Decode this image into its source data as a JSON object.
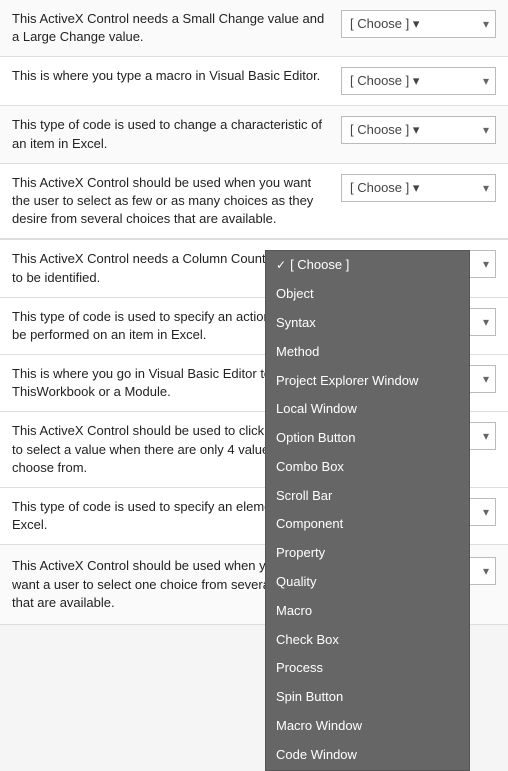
{
  "questions": [
    {
      "id": "q1",
      "text": "This ActiveX Control needs a Small Change value and a Large Change value.",
      "dropdown_value": "[ Choose ]",
      "open": false
    },
    {
      "id": "q2",
      "text": "This is where you type a macro in Visual Basic Editor.",
      "dropdown_value": "[ Choose ]",
      "open": false
    },
    {
      "id": "q3",
      "text": "This type of code is used to change a characteristic of an item in Excel.",
      "dropdown_value": "[ Choose ]",
      "open": false
    },
    {
      "id": "q4",
      "text": "This ActiveX Control should be used when you want the user to select as few or as many choices as they desire from several choices that are available.",
      "dropdown_value": "[ Choose ]",
      "open": false
    },
    {
      "id": "q5",
      "text": "This ActiveX Control needs a Column Count property to be identified.",
      "dropdown_value": "[ Choose ]",
      "open": true
    },
    {
      "id": "q6",
      "text": "This type of code is used to specify an action that will be performed on an item in Excel.",
      "dropdown_value": "[ Choose ]",
      "open": false,
      "behind_menu": true
    },
    {
      "id": "q7",
      "text": "This is where you go in Visual Basic Editor to access ThisWorkbook or a Module.",
      "dropdown_value": "[ Choose ]",
      "open": false,
      "behind_menu": true
    },
    {
      "id": "q8",
      "text": "This ActiveX Control should be used to click on arrows to select a value when there are only 4 values to choose from.",
      "dropdown_value": "[ Choose ]",
      "open": false,
      "behind_menu": true
    },
    {
      "id": "q9",
      "text": "This type of code is used to specify an element of Excel.",
      "dropdown_value": "[ Choose ]",
      "open": false,
      "behind_menu": true
    }
  ],
  "last_question": {
    "text": "This ActiveX Control should be used when you only want a user to select one choice from several choices that are available.",
    "dropdown_value": "[ Choose ]"
  },
  "dropdown_menu": {
    "items": [
      {
        "label": "[ Choose ]",
        "selected": true
      },
      {
        "label": "Object"
      },
      {
        "label": "Syntax"
      },
      {
        "label": "Method"
      },
      {
        "label": "Project Explorer Window"
      },
      {
        "label": "Local Window"
      },
      {
        "label": "Option Button"
      },
      {
        "label": "Combo Box"
      },
      {
        "label": "Scroll Bar"
      },
      {
        "label": "Component"
      },
      {
        "label": "Property"
      },
      {
        "label": "Quality"
      },
      {
        "label": "Macro"
      },
      {
        "label": "Check Box"
      },
      {
        "label": "Process"
      },
      {
        "label": "Spin Button"
      },
      {
        "label": "Macro Window"
      },
      {
        "label": "Code Window"
      }
    ]
  }
}
